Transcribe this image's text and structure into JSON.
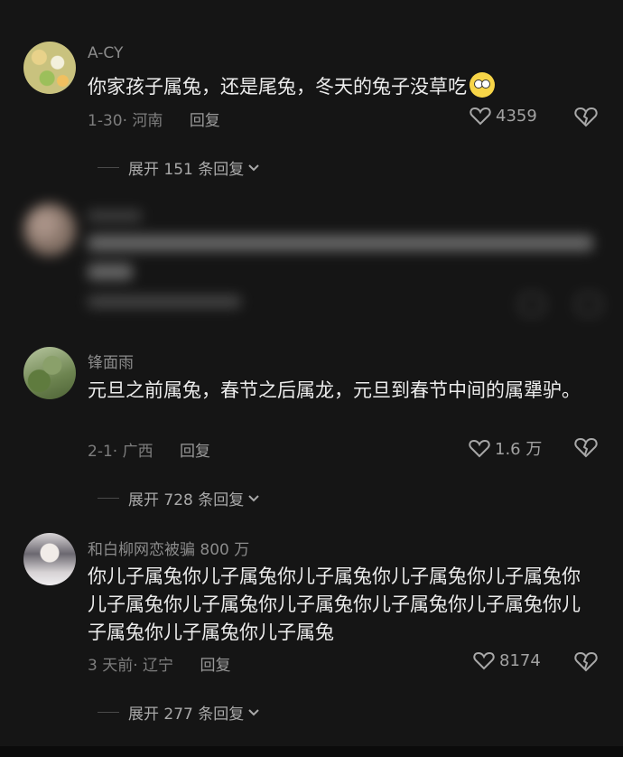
{
  "comments": [
    {
      "username": "A-CY",
      "text": "你家孩子属兔，还是尾兔，冬天的兔子没草吃",
      "date": "1-30",
      "location": "河南",
      "reply_label": "回复",
      "likes": "4359",
      "expand": "展开 151 条回复"
    },
    {
      "username": "",
      "text": "",
      "date": "",
      "location": "",
      "reply_label": "",
      "likes": "",
      "expand": ""
    },
    {
      "username": "锋面雨",
      "text": "元旦之前属兔，春节之后属龙，元旦到春节中间的属犟驴。",
      "date": "2-1",
      "location": "广西",
      "reply_label": "回复",
      "likes": "1.6 万",
      "expand": "展开 728 条回复"
    },
    {
      "username": "和白柳网恋被骗 800 万",
      "text": "你儿子属兔你儿子属兔你儿子属兔你儿子属兔你儿子属兔你儿子属兔你儿子属兔你儿子属兔你儿子属兔你儿子属兔你儿子属兔你儿子属兔你儿子属兔",
      "date": "3 天前",
      "location": "辽宁",
      "reply_label": "回复",
      "likes": "8174",
      "expand": "展开 277 条回复"
    }
  ],
  "colors": {
    "background": "#151515",
    "text": "#ececec",
    "muted": "#8b8b8b"
  },
  "icons": [
    "heart-icon",
    "broken-heart-icon",
    "chevron-down-icon",
    "emoji-flushed-icon"
  ]
}
